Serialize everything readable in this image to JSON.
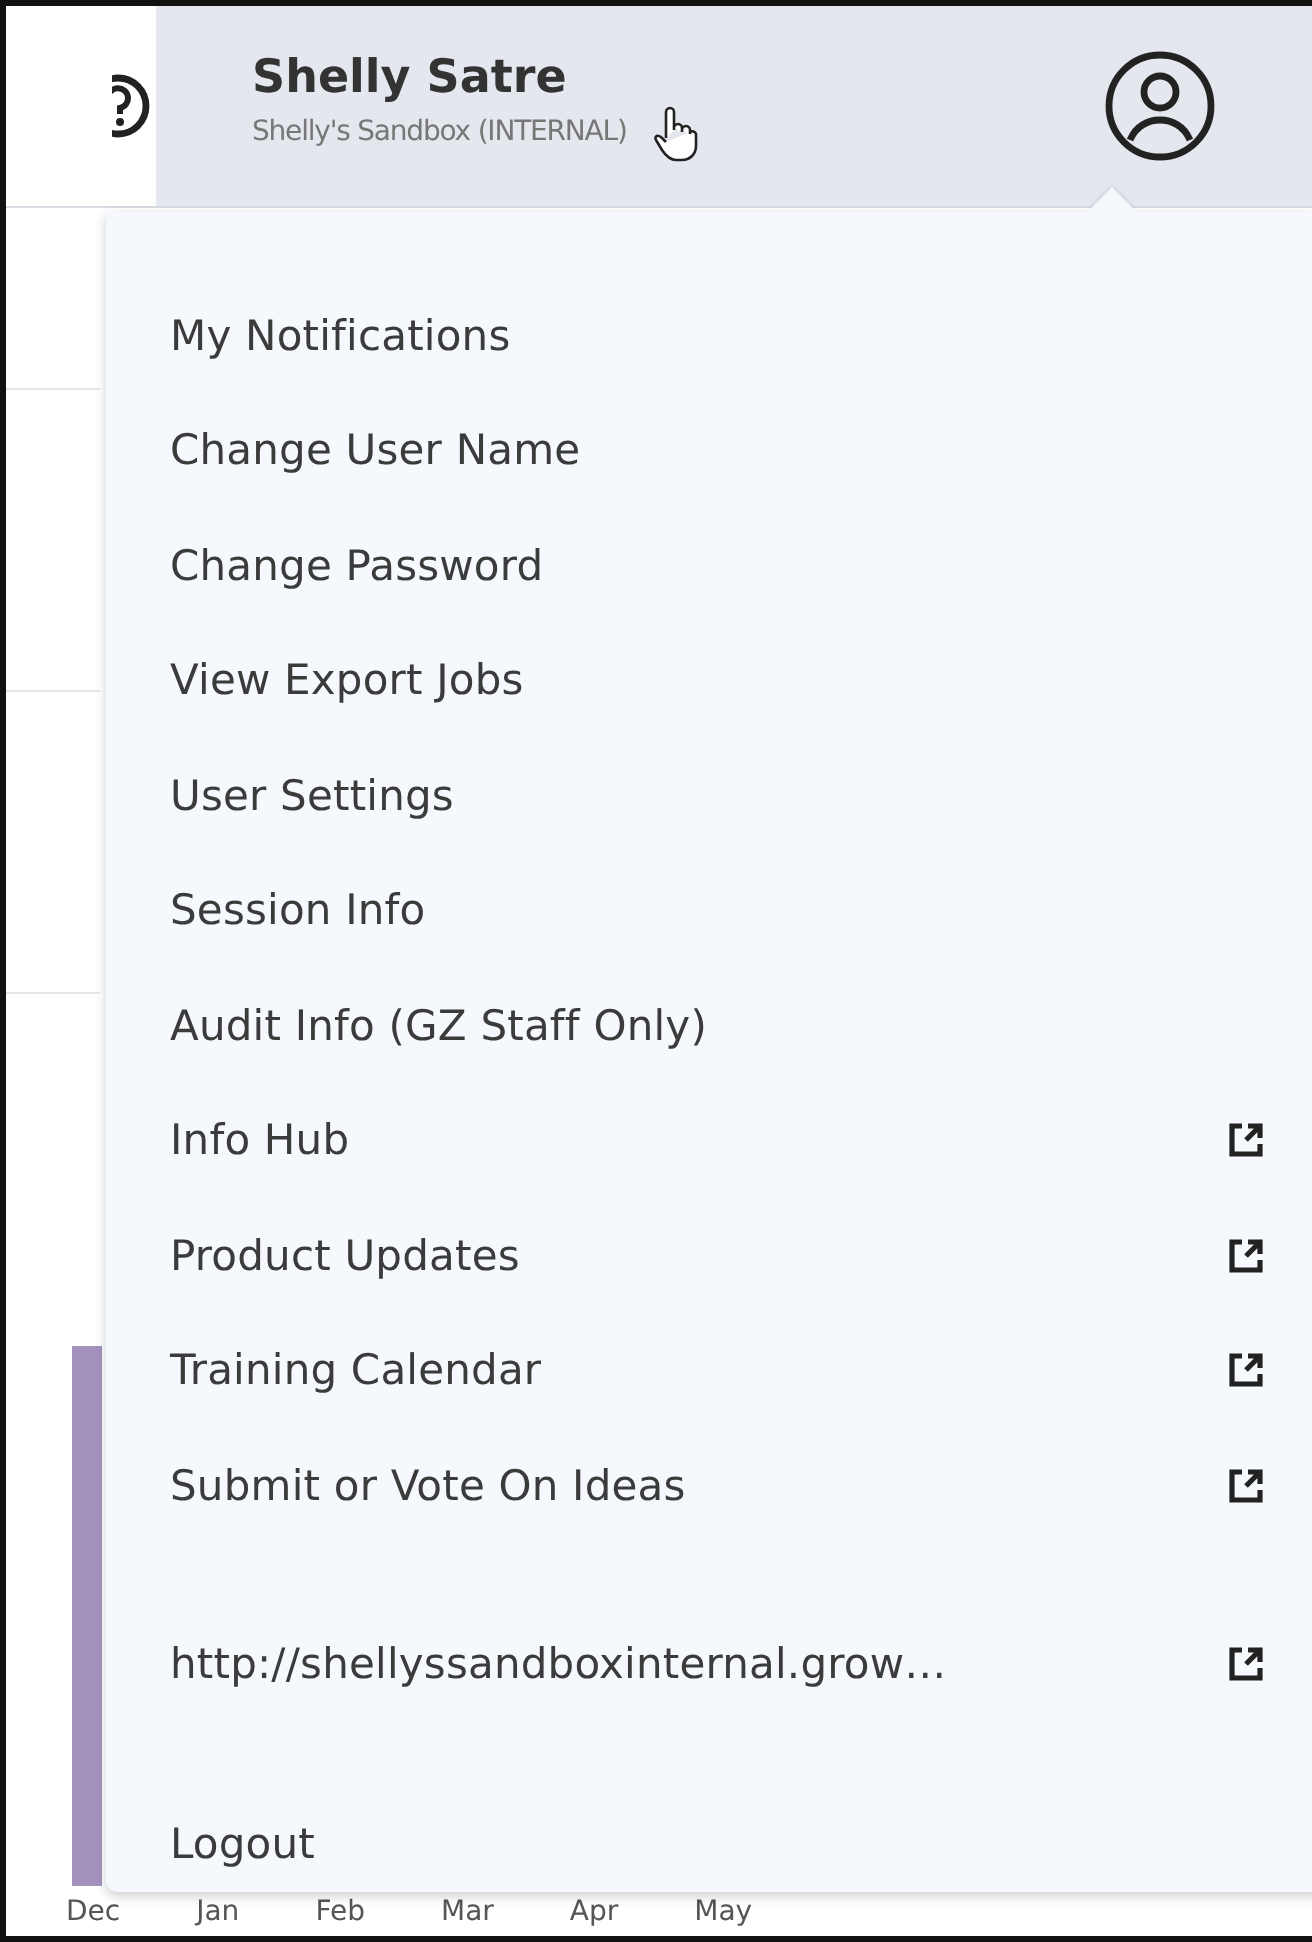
{
  "header": {
    "user_name": "Shelly Satre",
    "account": "Shelly's Sandbox (INTERNAL)"
  },
  "menu": {
    "sections": [
      [
        {
          "label": "My Notifications",
          "external": false
        },
        {
          "label": "Change User Name",
          "external": false
        },
        {
          "label": "Change Password",
          "external": false
        },
        {
          "label": "View Export Jobs",
          "external": false
        },
        {
          "label": "User Settings",
          "external": false
        },
        {
          "label": "Session Info",
          "external": false
        },
        {
          "label": "Audit Info (GZ Staff Only)",
          "external": false
        },
        {
          "label": "Info Hub",
          "external": true
        },
        {
          "label": "Product Updates",
          "external": true
        },
        {
          "label": "Training Calendar",
          "external": true
        },
        {
          "label": "Submit or Vote On Ideas",
          "external": true
        }
      ],
      [
        {
          "label": "http://shellyssandboxinternal.grow…",
          "external": true
        }
      ],
      [
        {
          "label": "Logout",
          "external": false
        }
      ]
    ]
  },
  "chart": {
    "x_labels": [
      "Dec",
      "Jan",
      "Feb",
      "Mar",
      "Apr",
      "May"
    ]
  }
}
